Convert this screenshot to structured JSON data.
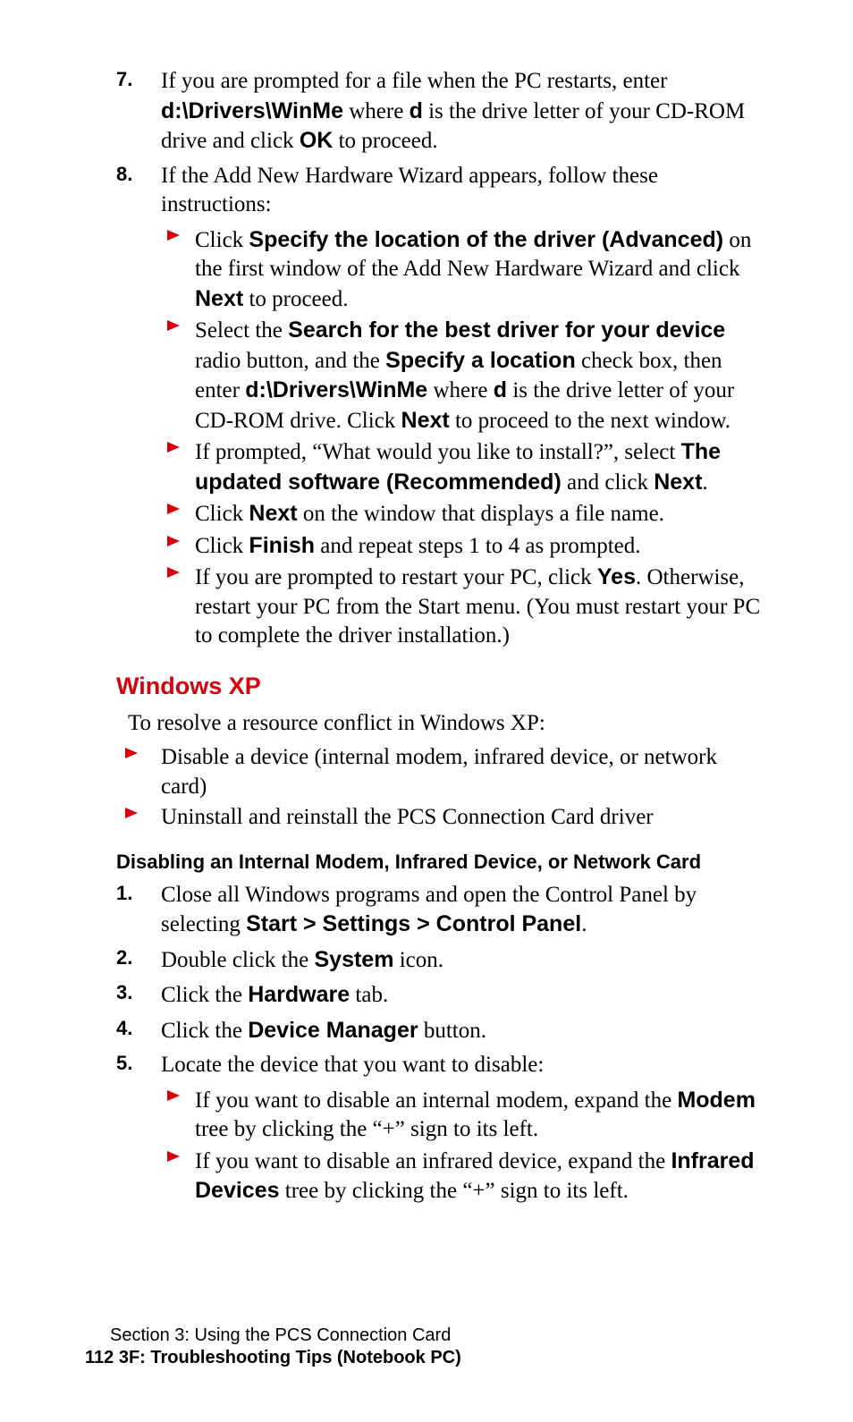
{
  "steps7": {
    "num": "7.",
    "t1": "If you are prompted for a file when the PC restarts, enter ",
    "b1": "d:\\Drivers\\WinMe",
    "t2": " where ",
    "b2": "d",
    "t3": " is the drive letter of your CD-ROM drive and click ",
    "b3": "OK",
    "t4": " to proceed."
  },
  "steps8": {
    "num": "8.",
    "t1": "If the Add New Hardware Wizard appears, follow these instructions:",
    "a": {
      "t1": "Click ",
      "b1": "Specify the location of the driver (Advanced)",
      "t2": " on the first window of the Add New Hardware Wizard and click ",
      "b2": "Next",
      "t3": " to proceed."
    },
    "b": {
      "t1": "Select the ",
      "b1": "Search for the best driver for your device",
      "t2": " radio button, and the ",
      "b2": "Specify a location",
      "t3": " check box, then enter ",
      "b3": "d:\\Drivers\\WinMe",
      "t4": " where ",
      "b4": "d",
      "t5": " is the drive letter of your CD-ROM drive. Click ",
      "b5": "Next",
      "t6": " to proceed to the next window."
    },
    "c": {
      "t1": "If prompted, “What would you like to install?”, select ",
      "b1": "The updated software (Recommended)",
      "t2": " and click ",
      "b2": "Next",
      "t3": "."
    },
    "d": {
      "t1": "Click ",
      "b1": "Next",
      "t2": " on the window that displays a file name."
    },
    "e": {
      "t1": "Click ",
      "b1": "Finish",
      "t2": " and repeat steps 1 to 4 as prompted."
    },
    "f": {
      "t1": "If you are prompted to restart your PC, click ",
      "b1": "Yes",
      "t2": ". Otherwise, restart your PC from the Start menu. (You must restart your PC to complete the driver installation.)"
    }
  },
  "hXP": "Windows XP",
  "pXP": "To resolve a resource conflict in Windows XP:",
  "xp_a": "Disable a device (internal modem, infrared device, or network card)",
  "xp_b": "Uninstall and reinstall the PCS Connection Card driver",
  "hDisable": "Disabling an Internal Modem, Infrared Device, or Network Card",
  "d1": {
    "num": "1.",
    "t1": "Close all Windows programs and open the Control Panel by selecting ",
    "b1": "Start > Settings > Control Panel",
    "t2": "."
  },
  "d2": {
    "num": "2.",
    "t1": "Double click the ",
    "b1": "System",
    "t2": " icon."
  },
  "d3": {
    "num": "3.",
    "t1": "Click the ",
    "b1": "Hardware",
    "t2": " tab."
  },
  "d4": {
    "num": "4.",
    "t1": "Click the ",
    "b1": "Device Manager",
    "t2": " button."
  },
  "d5": {
    "num": "5.",
    "t1": "Locate the device that you want to disable:",
    "a": {
      "t1": "If you want to disable an internal modem, expand the ",
      "b1": "Modem",
      "t2": " tree by clicking the “+” sign to its left."
    },
    "b": {
      "t1": "If you want to disable an infrared device, expand the ",
      "b1": "Infrared Devices",
      "t2": " tree by clicking the “+” sign to its left."
    }
  },
  "footer": {
    "section": "Section 3: Using the PCS Connection Card",
    "page": "112   3F: Troubleshooting Tips (Notebook PC)"
  }
}
